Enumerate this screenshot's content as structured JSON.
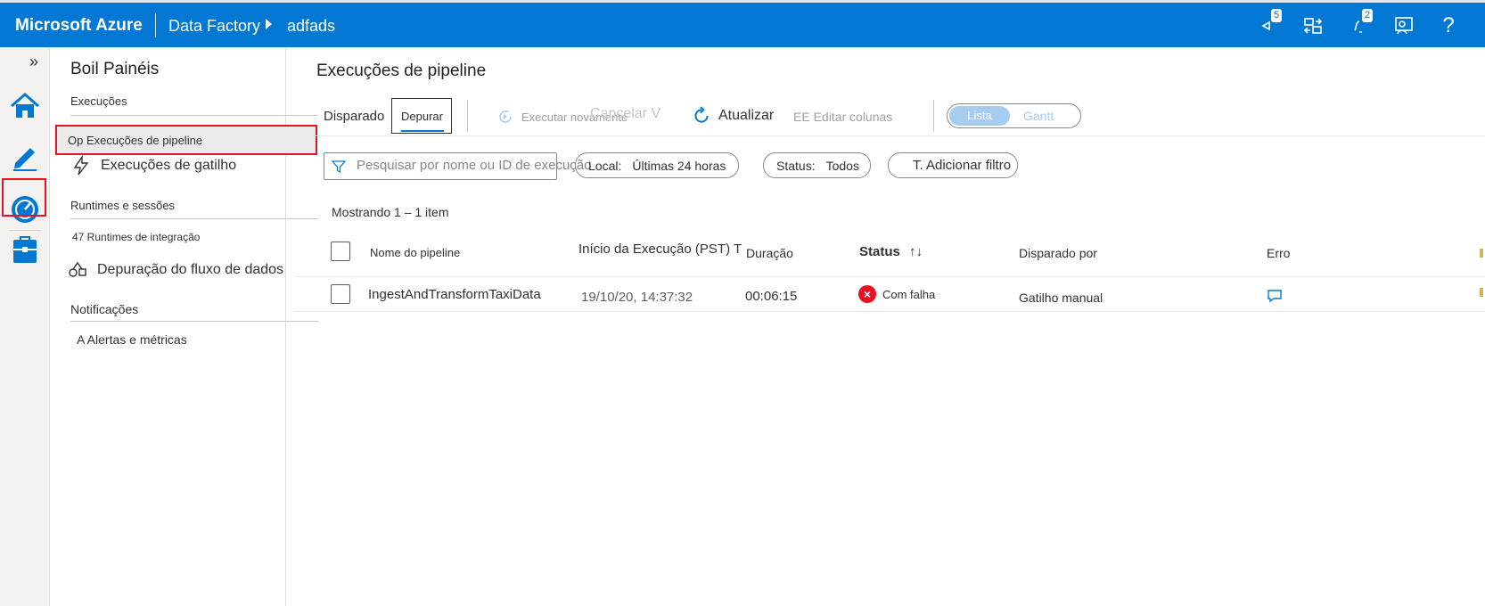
{
  "topbar": {
    "brand": "Microsoft Azure",
    "breadcrumb": [
      "Data Factory",
      "adfads"
    ],
    "badges": {
      "feedback": "5",
      "notifications": "2"
    },
    "help": "?"
  },
  "rail": {
    "collapse": "»"
  },
  "nav": {
    "title": "Boil Painéis",
    "section_runs": "Execuções",
    "pipeline_runs": "Op Execuções de pipeline",
    "trigger_runs": "Execuções de gatilho",
    "section_runtimes": "Runtimes e    sessões",
    "integration_runtimes": "47 Runtimes de integração",
    "dataflow_debug": "Depuração do fluxo de dados",
    "section_notifications": "Notificações",
    "alerts": "A Alertas e  métricas"
  },
  "main": {
    "title": "Execuções de pipeline",
    "tabs": {
      "triggered": "Disparado",
      "debug": "Depurar"
    },
    "commands": {
      "rerun": "Executar novamente",
      "cancel": "Cancelar V",
      "refresh": "Atualizar",
      "edit_columns": "EE Editar colunas"
    },
    "view_toggle": {
      "list": "Lista",
      "gantt": "Gantt"
    },
    "filters": {
      "search_placeholder": "Pesquisar por nome ou ID de execução",
      "local_label": "Local:",
      "local_value": "Últimas 24 horas",
      "status_label": "Status:",
      "status_value": "Todos",
      "add_filter": "T. Adicionar filtro"
    },
    "showing": "Mostrando 1 – 1 item",
    "columns": {
      "pipeline_name": "Nome do pipeline",
      "run_start": "Início da Execução (PST) T",
      "duration": "Duração",
      "status": "Status",
      "sort_glyph": "↑↓",
      "triggered_by": "Disparado por",
      "error": "Erro"
    },
    "rows": [
      {
        "pipeline_name": "IngestAndTransformTaxiData",
        "run_start": "19/10/20, 14:37:32",
        "duration": "00:06:15",
        "status": "Com falha",
        "triggered_by": "Gatilho manual"
      }
    ]
  },
  "colors": {
    "accent": "#0078d4",
    "highlight": "#e81123",
    "toggle_on": "#a6cdf0"
  }
}
